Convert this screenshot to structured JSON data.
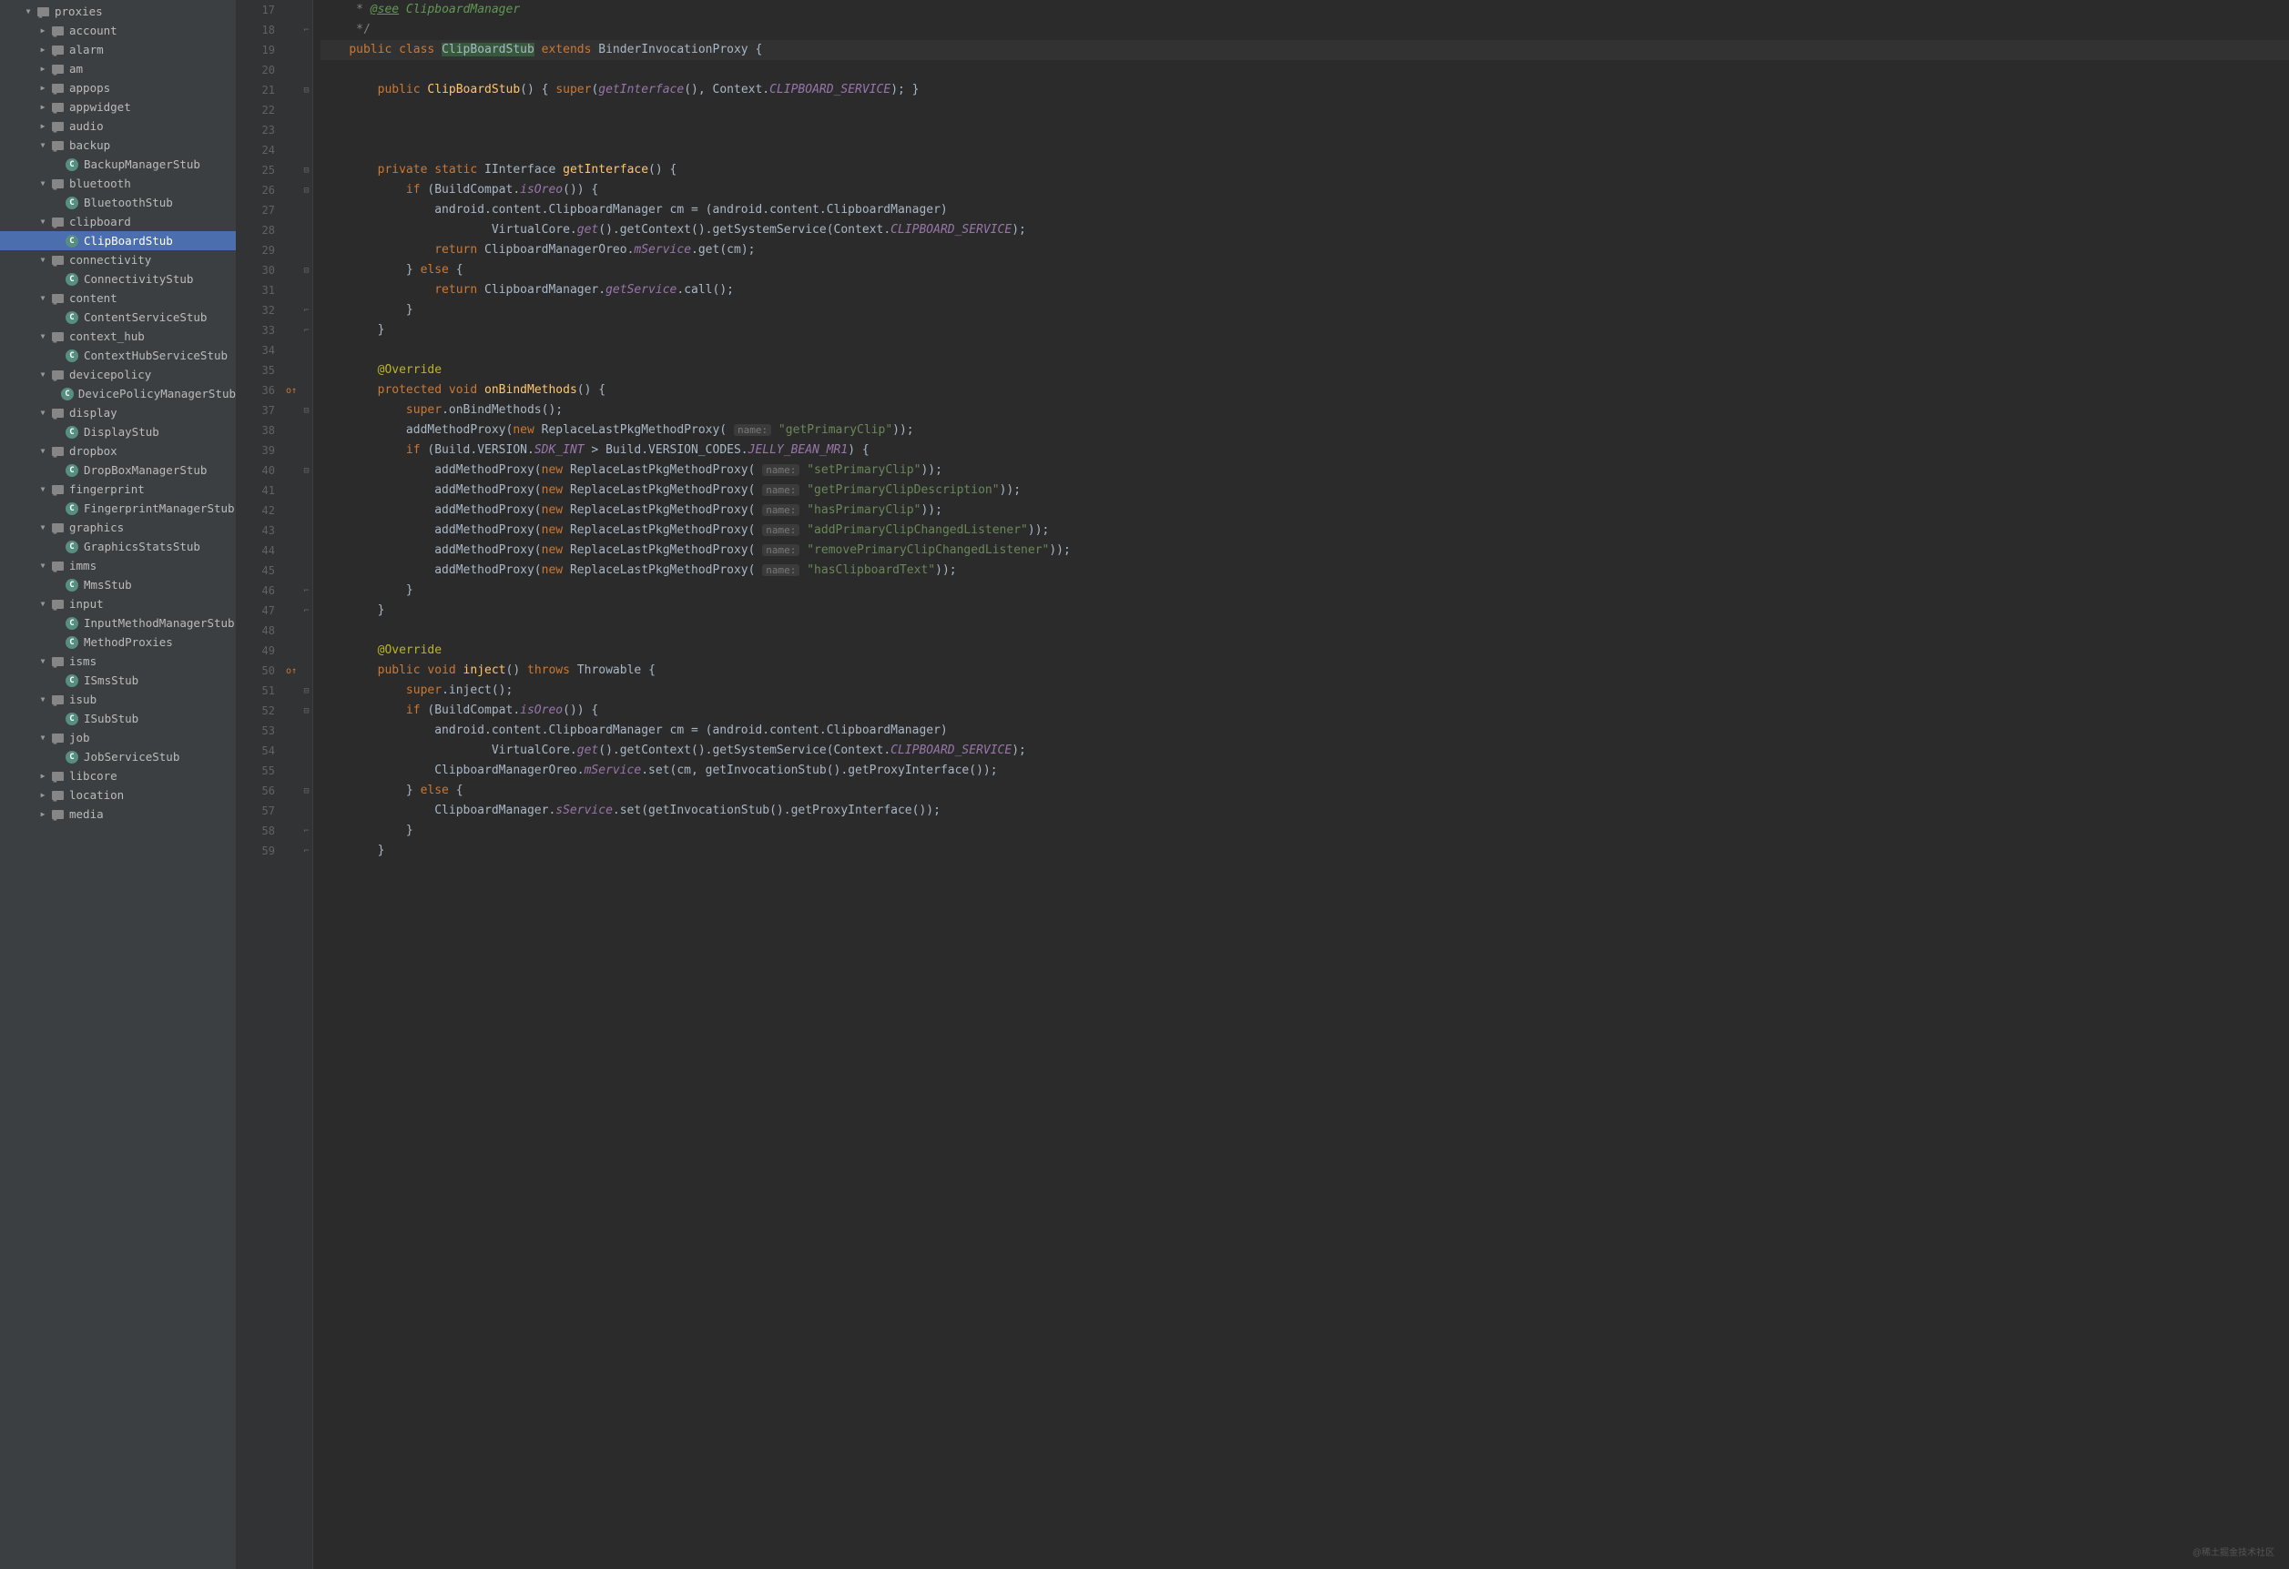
{
  "watermark": "@稀土掘金技术社区",
  "tree": [
    {
      "depth": 1,
      "arrow": "down",
      "icon": "folder",
      "label": "proxies"
    },
    {
      "depth": 2,
      "arrow": "right",
      "icon": "folder",
      "label": "account"
    },
    {
      "depth": 2,
      "arrow": "right",
      "icon": "folder",
      "label": "alarm"
    },
    {
      "depth": 2,
      "arrow": "right",
      "icon": "folder",
      "label": "am"
    },
    {
      "depth": 2,
      "arrow": "right",
      "icon": "folder",
      "label": "appops"
    },
    {
      "depth": 2,
      "arrow": "right",
      "icon": "folder",
      "label": "appwidget"
    },
    {
      "depth": 2,
      "arrow": "right",
      "icon": "folder",
      "label": "audio"
    },
    {
      "depth": 2,
      "arrow": "down",
      "icon": "folder",
      "label": "backup"
    },
    {
      "depth": 3,
      "arrow": "",
      "icon": "class",
      "label": "BackupManagerStub"
    },
    {
      "depth": 2,
      "arrow": "down",
      "icon": "folder",
      "label": "bluetooth"
    },
    {
      "depth": 3,
      "arrow": "",
      "icon": "class",
      "label": "BluetoothStub"
    },
    {
      "depth": 2,
      "arrow": "down",
      "icon": "folder",
      "label": "clipboard"
    },
    {
      "depth": 3,
      "arrow": "",
      "icon": "class",
      "label": "ClipBoardStub",
      "selected": true
    },
    {
      "depth": 2,
      "arrow": "down",
      "icon": "folder",
      "label": "connectivity"
    },
    {
      "depth": 3,
      "arrow": "",
      "icon": "class",
      "label": "ConnectivityStub"
    },
    {
      "depth": 2,
      "arrow": "down",
      "icon": "folder",
      "label": "content"
    },
    {
      "depth": 3,
      "arrow": "",
      "icon": "class",
      "label": "ContentServiceStub"
    },
    {
      "depth": 2,
      "arrow": "down",
      "icon": "folder",
      "label": "context_hub"
    },
    {
      "depth": 3,
      "arrow": "",
      "icon": "class",
      "label": "ContextHubServiceStub"
    },
    {
      "depth": 2,
      "arrow": "down",
      "icon": "folder",
      "label": "devicepolicy"
    },
    {
      "depth": 3,
      "arrow": "",
      "icon": "class",
      "label": "DevicePolicyManagerStub"
    },
    {
      "depth": 2,
      "arrow": "down",
      "icon": "folder",
      "label": "display"
    },
    {
      "depth": 3,
      "arrow": "",
      "icon": "class",
      "label": "DisplayStub"
    },
    {
      "depth": 2,
      "arrow": "down",
      "icon": "folder",
      "label": "dropbox"
    },
    {
      "depth": 3,
      "arrow": "",
      "icon": "class",
      "label": "DropBoxManagerStub"
    },
    {
      "depth": 2,
      "arrow": "down",
      "icon": "folder",
      "label": "fingerprint"
    },
    {
      "depth": 3,
      "arrow": "",
      "icon": "class",
      "label": "FingerprintManagerStub"
    },
    {
      "depth": 2,
      "arrow": "down",
      "icon": "folder",
      "label": "graphics"
    },
    {
      "depth": 3,
      "arrow": "",
      "icon": "class",
      "label": "GraphicsStatsStub"
    },
    {
      "depth": 2,
      "arrow": "down",
      "icon": "folder",
      "label": "imms"
    },
    {
      "depth": 3,
      "arrow": "",
      "icon": "class",
      "label": "MmsStub"
    },
    {
      "depth": 2,
      "arrow": "down",
      "icon": "folder",
      "label": "input"
    },
    {
      "depth": 3,
      "arrow": "",
      "icon": "class",
      "label": "InputMethodManagerStub"
    },
    {
      "depth": 3,
      "arrow": "",
      "icon": "class",
      "label": "MethodProxies"
    },
    {
      "depth": 2,
      "arrow": "down",
      "icon": "folder",
      "label": "isms"
    },
    {
      "depth": 3,
      "arrow": "",
      "icon": "class",
      "label": "ISmsStub"
    },
    {
      "depth": 2,
      "arrow": "down",
      "icon": "folder",
      "label": "isub"
    },
    {
      "depth": 3,
      "arrow": "",
      "icon": "class",
      "label": "ISubStub"
    },
    {
      "depth": 2,
      "arrow": "down",
      "icon": "folder",
      "label": "job"
    },
    {
      "depth": 3,
      "arrow": "",
      "icon": "class",
      "label": "JobServiceStub"
    },
    {
      "depth": 2,
      "arrow": "right",
      "icon": "folder",
      "label": "libcore"
    },
    {
      "depth": 2,
      "arrow": "right",
      "icon": "folder",
      "label": "location"
    },
    {
      "depth": 2,
      "arrow": "right",
      "icon": "folder",
      "label": "media"
    }
  ],
  "gutter": {
    "start": 17,
    "end": 59,
    "marks": {
      "36": "override",
      "50": "override"
    },
    "folds": {
      "17": "",
      "18": "close",
      "19": " ",
      "20": "",
      "21": "open",
      "22": "",
      "23": "",
      "24": "",
      "25": "open",
      "26": "open",
      "27": "",
      "28": "",
      "29": "",
      "30": "open",
      "31": "",
      "32": "close",
      "33": "close",
      "34": "",
      "35": "",
      "36": "",
      "37": "open",
      "38": "",
      "39": "",
      "40": "open",
      "41": "",
      "42": "",
      "43": "",
      "44": "",
      "45": "",
      "46": "close",
      "47": "close",
      "48": "",
      "49": "",
      "50": "",
      "51": "open",
      "52": "open",
      "53": "",
      "54": "",
      "55": "",
      "56": "open",
      "57": "",
      "58": "close",
      "59": "close"
    }
  },
  "code": [
    {
      "n": 17,
      "segs": [
        [
          "     * ",
          "comment"
        ],
        [
          "@see",
          "doctag"
        ],
        [
          " ClipboardManager",
          "doc"
        ]
      ]
    },
    {
      "n": 18,
      "segs": [
        [
          "     */",
          "comment"
        ]
      ]
    },
    {
      "n": 19,
      "current": true,
      "segs": [
        [
          "    ",
          ""
        ],
        [
          "public class ",
          "kw"
        ],
        [
          "ClipBoardStub",
          "hl"
        ],
        [
          " ",
          ""
        ],
        [
          "extends",
          "kw"
        ],
        [
          " BinderInvocationProxy {",
          ""
        ]
      ]
    },
    {
      "n": 20,
      "segs": [
        [
          "",
          ""
        ]
      ]
    },
    {
      "n": 21,
      "segs": [
        [
          "        ",
          ""
        ],
        [
          "public ",
          "kw"
        ],
        [
          "ClipBoardStub",
          "method"
        ],
        [
          "() { ",
          ""
        ],
        [
          "super",
          "kw"
        ],
        [
          "(",
          ""
        ],
        [
          "getInterface",
          "field"
        ],
        [
          "(), Context.",
          ""
        ],
        [
          "CLIPBOARD_SERVICE",
          "const"
        ],
        [
          "); }",
          ""
        ]
      ]
    },
    {
      "n": 22,
      "segs": [
        [
          "",
          ""
        ]
      ]
    },
    {
      "n": 23,
      "segs": [
        [
          "",
          ""
        ]
      ]
    },
    {
      "n": 24,
      "segs": [
        [
          "",
          ""
        ]
      ]
    },
    {
      "n": 25,
      "segs": [
        [
          "        ",
          ""
        ],
        [
          "private static ",
          "kw"
        ],
        [
          "IInterface ",
          ""
        ],
        [
          "getInterface",
          "method"
        ],
        [
          "() {",
          ""
        ]
      ]
    },
    {
      "n": 26,
      "segs": [
        [
          "            ",
          ""
        ],
        [
          "if ",
          "kw"
        ],
        [
          "(BuildCompat.",
          ""
        ],
        [
          "isOreo",
          "field"
        ],
        [
          "()) {",
          ""
        ]
      ]
    },
    {
      "n": 27,
      "segs": [
        [
          "                android.content.ClipboardManager cm = (android.content.ClipboardManager)",
          ""
        ]
      ]
    },
    {
      "n": 28,
      "segs": [
        [
          "                        VirtualCore.",
          ""
        ],
        [
          "get",
          "field"
        ],
        [
          "().getContext().getSystemService(Context.",
          ""
        ],
        [
          "CLIPBOARD_SERVICE",
          "const"
        ],
        [
          ");",
          ""
        ]
      ]
    },
    {
      "n": 29,
      "segs": [
        [
          "                ",
          ""
        ],
        [
          "return ",
          "kw"
        ],
        [
          "ClipboardManagerOreo.",
          ""
        ],
        [
          "mService",
          "const"
        ],
        [
          ".get(cm);",
          ""
        ]
      ]
    },
    {
      "n": 30,
      "segs": [
        [
          "            } ",
          ""
        ],
        [
          "else ",
          "kw"
        ],
        [
          "{",
          ""
        ]
      ]
    },
    {
      "n": 31,
      "segs": [
        [
          "                ",
          ""
        ],
        [
          "return ",
          "kw"
        ],
        [
          "ClipboardManager.",
          ""
        ],
        [
          "getService",
          "const"
        ],
        [
          ".call();",
          ""
        ]
      ]
    },
    {
      "n": 32,
      "segs": [
        [
          "            }",
          ""
        ]
      ]
    },
    {
      "n": 33,
      "segs": [
        [
          "        }",
          ""
        ]
      ]
    },
    {
      "n": 34,
      "segs": [
        [
          "",
          ""
        ]
      ]
    },
    {
      "n": 35,
      "segs": [
        [
          "        ",
          ""
        ],
        [
          "@Override",
          "anno"
        ]
      ]
    },
    {
      "n": 36,
      "segs": [
        [
          "        ",
          ""
        ],
        [
          "protected void ",
          "kw"
        ],
        [
          "onBindMethods",
          "method"
        ],
        [
          "() {",
          ""
        ]
      ]
    },
    {
      "n": 37,
      "segs": [
        [
          "            ",
          ""
        ],
        [
          "super",
          "kw"
        ],
        [
          ".onBindMethods();",
          ""
        ]
      ]
    },
    {
      "n": 38,
      "segs": [
        [
          "            addMethodProxy(",
          ""
        ],
        [
          "new ",
          "kw"
        ],
        [
          "ReplaceLastPkgMethodProxy( ",
          ""
        ],
        [
          "name:",
          "hint"
        ],
        [
          " ",
          ""
        ],
        [
          "\"getPrimaryClip\"",
          "str"
        ],
        [
          "));",
          ""
        ]
      ]
    },
    {
      "n": 39,
      "segs": [
        [
          "            ",
          ""
        ],
        [
          "if ",
          "kw"
        ],
        [
          "(Build.VERSION.",
          ""
        ],
        [
          "SDK_INT",
          "const"
        ],
        [
          " > Build.VERSION_CODES.",
          ""
        ],
        [
          "JELLY_BEAN_MR1",
          "const"
        ],
        [
          ") {",
          ""
        ]
      ]
    },
    {
      "n": 40,
      "segs": [
        [
          "                addMethodProxy(",
          ""
        ],
        [
          "new ",
          "kw"
        ],
        [
          "ReplaceLastPkgMethodProxy( ",
          ""
        ],
        [
          "name:",
          "hint"
        ],
        [
          " ",
          ""
        ],
        [
          "\"setPrimaryClip\"",
          "str"
        ],
        [
          "));",
          ""
        ]
      ]
    },
    {
      "n": 41,
      "segs": [
        [
          "                addMethodProxy(",
          ""
        ],
        [
          "new ",
          "kw"
        ],
        [
          "ReplaceLastPkgMethodProxy( ",
          ""
        ],
        [
          "name:",
          "hint"
        ],
        [
          " ",
          ""
        ],
        [
          "\"getPrimaryClipDescription\"",
          "str"
        ],
        [
          "));",
          ""
        ]
      ]
    },
    {
      "n": 42,
      "segs": [
        [
          "                addMethodProxy(",
          ""
        ],
        [
          "new ",
          "kw"
        ],
        [
          "ReplaceLastPkgMethodProxy( ",
          ""
        ],
        [
          "name:",
          "hint"
        ],
        [
          " ",
          ""
        ],
        [
          "\"hasPrimaryClip\"",
          "str"
        ],
        [
          "));",
          ""
        ]
      ]
    },
    {
      "n": 43,
      "segs": [
        [
          "                addMethodProxy(",
          ""
        ],
        [
          "new ",
          "kw"
        ],
        [
          "ReplaceLastPkgMethodProxy( ",
          ""
        ],
        [
          "name:",
          "hint"
        ],
        [
          " ",
          ""
        ],
        [
          "\"addPrimaryClipChangedListener\"",
          "str"
        ],
        [
          "));",
          ""
        ]
      ]
    },
    {
      "n": 44,
      "segs": [
        [
          "                addMethodProxy(",
          ""
        ],
        [
          "new ",
          "kw"
        ],
        [
          "ReplaceLastPkgMethodProxy( ",
          ""
        ],
        [
          "name:",
          "hint"
        ],
        [
          " ",
          ""
        ],
        [
          "\"removePrimaryClipChangedListener\"",
          "str"
        ],
        [
          "));",
          ""
        ]
      ]
    },
    {
      "n": 45,
      "segs": [
        [
          "                addMethodProxy(",
          ""
        ],
        [
          "new ",
          "kw"
        ],
        [
          "ReplaceLastPkgMethodProxy( ",
          ""
        ],
        [
          "name:",
          "hint"
        ],
        [
          " ",
          ""
        ],
        [
          "\"hasClipboardText\"",
          "str"
        ],
        [
          "));",
          ""
        ]
      ]
    },
    {
      "n": 46,
      "segs": [
        [
          "            }",
          ""
        ]
      ]
    },
    {
      "n": 47,
      "segs": [
        [
          "        }",
          ""
        ]
      ]
    },
    {
      "n": 48,
      "segs": [
        [
          "",
          ""
        ]
      ]
    },
    {
      "n": 49,
      "segs": [
        [
          "        ",
          ""
        ],
        [
          "@Override",
          "anno"
        ]
      ]
    },
    {
      "n": 50,
      "segs": [
        [
          "        ",
          ""
        ],
        [
          "public void ",
          "kw"
        ],
        [
          "inject",
          "method"
        ],
        [
          "() ",
          ""
        ],
        [
          "throws ",
          "kw"
        ],
        [
          "Throwable {",
          ""
        ]
      ]
    },
    {
      "n": 51,
      "segs": [
        [
          "            ",
          ""
        ],
        [
          "super",
          "kw"
        ],
        [
          ".inject();",
          ""
        ]
      ]
    },
    {
      "n": 52,
      "segs": [
        [
          "            ",
          ""
        ],
        [
          "if ",
          "kw"
        ],
        [
          "(BuildCompat.",
          ""
        ],
        [
          "isOreo",
          "field"
        ],
        [
          "()) {",
          ""
        ]
      ]
    },
    {
      "n": 53,
      "segs": [
        [
          "                android.content.ClipboardManager cm = (android.content.ClipboardManager)",
          ""
        ]
      ]
    },
    {
      "n": 54,
      "segs": [
        [
          "                        VirtualCore.",
          ""
        ],
        [
          "get",
          "field"
        ],
        [
          "().getContext().getSystemService(Context.",
          ""
        ],
        [
          "CLIPBOARD_SERVICE",
          "const"
        ],
        [
          ");",
          ""
        ]
      ]
    },
    {
      "n": 55,
      "segs": [
        [
          "                ClipboardManagerOreo.",
          ""
        ],
        [
          "mService",
          "const"
        ],
        [
          ".set(cm, getInvocationStub().getProxyInterface());",
          ""
        ]
      ]
    },
    {
      "n": 56,
      "segs": [
        [
          "            } ",
          ""
        ],
        [
          "else ",
          "kw"
        ],
        [
          "{",
          ""
        ]
      ]
    },
    {
      "n": 57,
      "segs": [
        [
          "                ClipboardManager.",
          ""
        ],
        [
          "sService",
          "const"
        ],
        [
          ".set(getInvocationStub().getProxyInterface());",
          ""
        ]
      ]
    },
    {
      "n": 58,
      "segs": [
        [
          "            }",
          ""
        ]
      ]
    },
    {
      "n": 59,
      "segs": [
        [
          "        }",
          ""
        ]
      ]
    }
  ]
}
